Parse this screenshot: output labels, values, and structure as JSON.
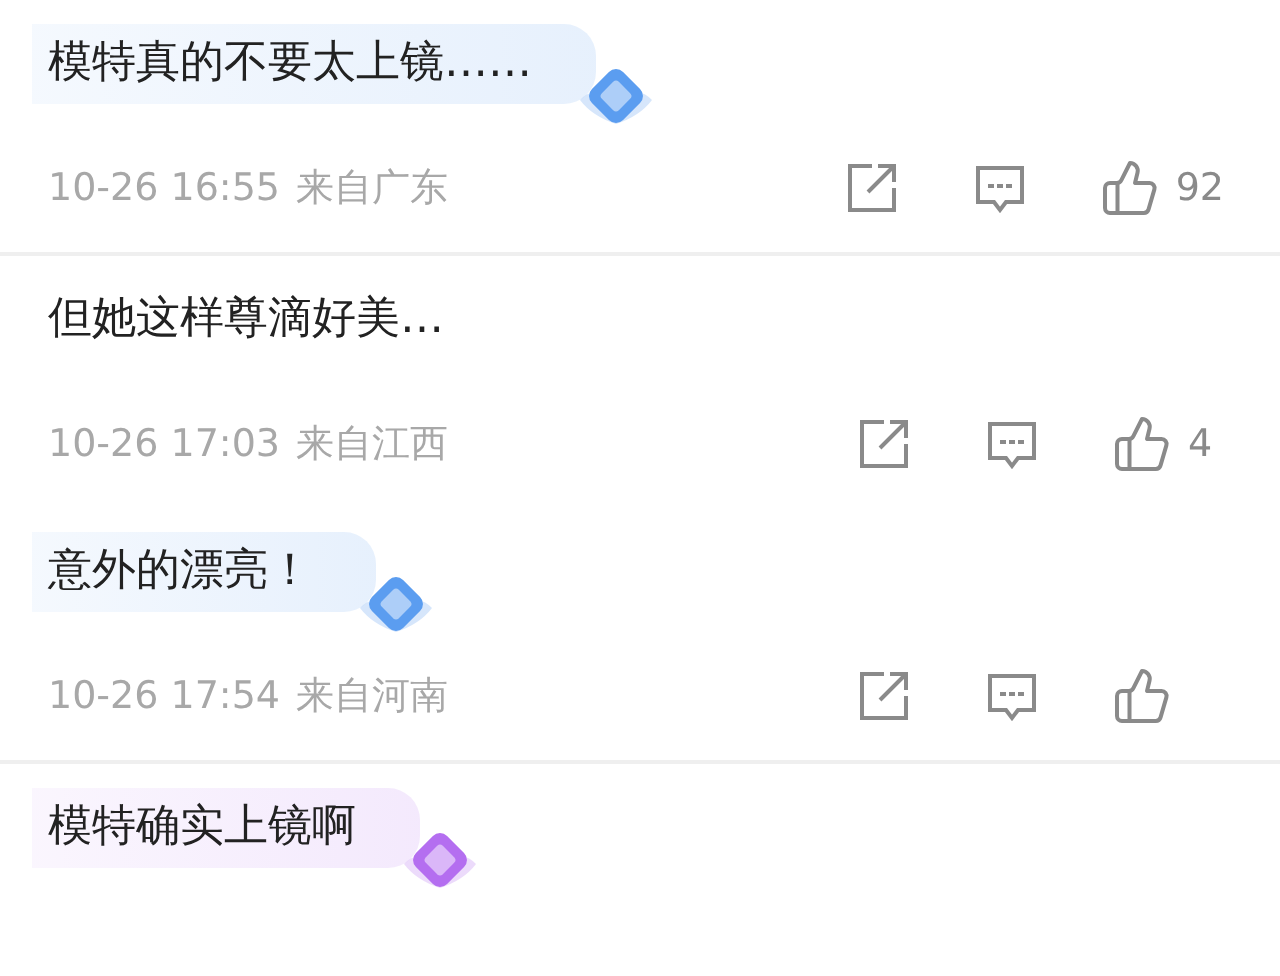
{
  "comments": [
    {
      "text": "模特真的不要太上镜……",
      "color": "#5b9df0",
      "time": "10-26 16:55",
      "location": "来自广东",
      "likes": "92"
    },
    {
      "text": "但她这样尊滴好美…",
      "time": "10-26 17:03",
      "location": "来自江西",
      "likes": "4"
    },
    {
      "text": "意外的漂亮！",
      "color": "#5b9df0",
      "time": "10-26 17:54",
      "location": "来自河南"
    },
    {
      "text": "模特确实上镜啊",
      "color": "#b46ef0"
    }
  ]
}
